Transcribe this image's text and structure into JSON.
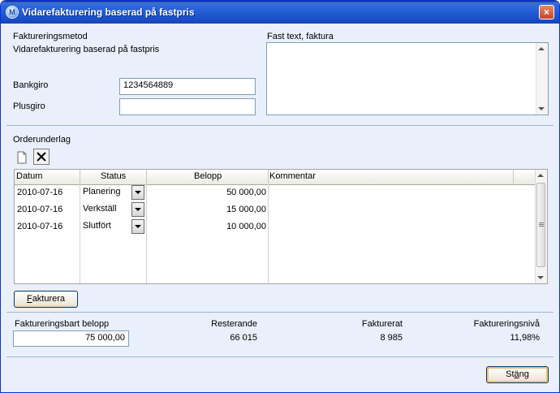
{
  "window": {
    "title": "Vidarefakturering baserad på fastpris",
    "close_symbol": "×"
  },
  "header": {
    "method_label": "Faktureringsmetod",
    "method_value": "Vidarefakturering baserad på fastpris",
    "bankgiro_label": "Bankgiro",
    "bankgiro_value": "1234564889",
    "plusgiro_label": "Plusgiro",
    "plusgiro_value": "",
    "fixed_text_label": "Fast text, faktura",
    "fixed_text_value": ""
  },
  "orders": {
    "section_label": "Orderunderlag",
    "columns": [
      "Datum",
      "Status",
      "Belopp",
      "Kommentar"
    ],
    "rows": [
      {
        "date": "2010-07-16",
        "status": "Planering",
        "amount": "50 000,00",
        "comment": ""
      },
      {
        "date": "2010-07-16",
        "status": "Verkställ",
        "amount": "15 000,00",
        "comment": ""
      },
      {
        "date": "2010-07-16",
        "status": "Slutfört",
        "amount": "10 000,00",
        "comment": ""
      }
    ],
    "invoice_button": {
      "accel": "F",
      "rest": "akturera"
    }
  },
  "summary": {
    "billable_label": "Faktureringsbart belopp",
    "billable_value": "75 000,00",
    "remaining_label": "Resterande",
    "remaining_value": "66 015",
    "invoiced_label": "Fakturerat",
    "invoiced_value": "8 985",
    "level_label": "Faktureringsnivå",
    "level_value": "11,98%"
  },
  "footer": {
    "close_button": {
      "pre": "St",
      "accel": "ä",
      "post": "ng"
    }
  },
  "colors": {
    "title_bar": "#2561d8",
    "window_bg": "#e9effb",
    "separator": "#9bb4dc"
  }
}
